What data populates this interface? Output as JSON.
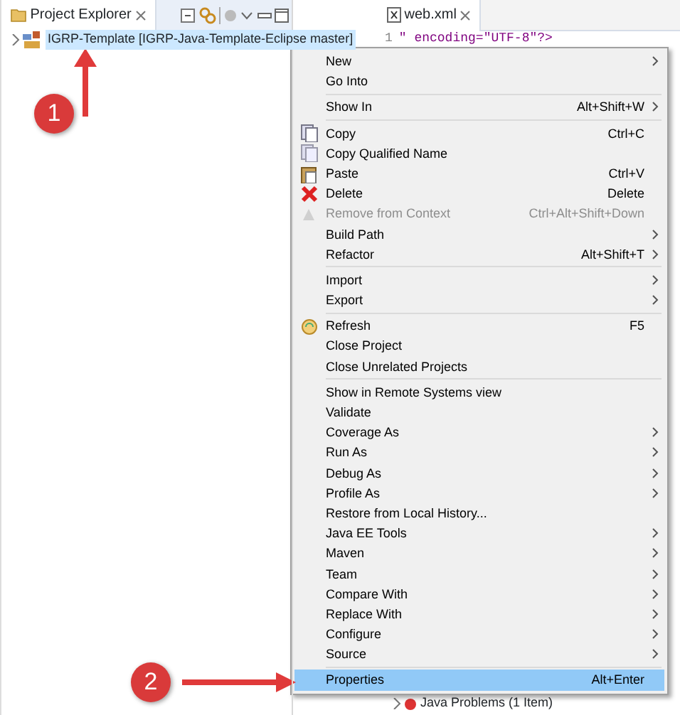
{
  "explorer": {
    "title": "Project Explorer",
    "tree": [
      {
        "label": "IGRP-Template [IGRP-Java-Template-Eclipse master]",
        "expanded": false,
        "selected": true
      }
    ]
  },
  "editor": {
    "tab": "web.xml",
    "lines": [
      {
        "number": "1",
        "code": "\" encoding=\"UTF-8\"?>"
      }
    ],
    "problems": "Java Problems (1 Item)"
  },
  "context_menu": {
    "groups": [
      [
        {
          "label": "New",
          "submenu": true,
          "kind": "plain",
          "disabled": false,
          "selected": false
        },
        {
          "label": "Go Into",
          "submenu": false,
          "kind": "plain",
          "disabled": false,
          "selected": false
        }
      ],
      [
        {
          "label": "Show In",
          "shortcut": "Alt+Shift+W",
          "submenu": true,
          "kind": "plain",
          "disabled": false,
          "selected": false
        }
      ],
      [
        {
          "label": "Copy",
          "shortcut": "Ctrl+C",
          "submenu": false,
          "kind": "copy",
          "disabled": false,
          "selected": false
        },
        {
          "label": "Copy Qualified Name",
          "submenu": false,
          "kind": "copy-name",
          "disabled": false,
          "selected": false
        },
        {
          "label": "Paste",
          "shortcut": "Ctrl+V",
          "submenu": false,
          "kind": "paste",
          "disabled": false,
          "selected": false
        },
        {
          "label": "Delete",
          "shortcut": "Delete",
          "submenu": false,
          "kind": "delete",
          "disabled": false,
          "selected": false
        },
        {
          "label": "Remove from Context",
          "shortcut": "Ctrl+Alt+Shift+Down",
          "submenu": false,
          "kind": "remove",
          "disabled": true,
          "selected": false
        },
        {
          "label": "Build Path",
          "submenu": true,
          "kind": "plain",
          "disabled": false,
          "selected": false
        },
        {
          "label": "Refactor",
          "shortcut": "Alt+Shift+T",
          "submenu": true,
          "kind": "plain",
          "disabled": false,
          "selected": false
        }
      ],
      [
        {
          "label": "Import",
          "submenu": true,
          "kind": "plain",
          "disabled": false,
          "selected": false
        },
        {
          "label": "Export",
          "submenu": true,
          "kind": "plain",
          "disabled": false,
          "selected": false
        }
      ],
      [
        {
          "label": "Refresh",
          "shortcut": "F5",
          "submenu": false,
          "kind": "refresh",
          "disabled": false,
          "selected": false
        },
        {
          "label": "Close Project",
          "submenu": false,
          "kind": "plain",
          "disabled": false,
          "selected": false
        },
        {
          "label": "Close Unrelated Projects",
          "submenu": false,
          "kind": "plain",
          "disabled": false,
          "selected": false
        }
      ],
      [
        {
          "label": "Show in Remote Systems view",
          "submenu": false,
          "kind": "plain",
          "disabled": false,
          "selected": false
        },
        {
          "label": "Validate",
          "submenu": false,
          "kind": "plain",
          "disabled": false,
          "selected": false
        },
        {
          "label": "Coverage As",
          "submenu": true,
          "kind": "plain",
          "disabled": false,
          "selected": false
        },
        {
          "label": "Run As",
          "submenu": true,
          "kind": "plain",
          "disabled": false,
          "selected": false
        },
        {
          "label": "Debug As",
          "submenu": true,
          "kind": "plain",
          "disabled": false,
          "selected": false
        },
        {
          "label": "Profile As",
          "submenu": true,
          "kind": "plain",
          "disabled": false,
          "selected": false
        },
        {
          "label": "Restore from Local History...",
          "submenu": false,
          "kind": "plain",
          "disabled": false,
          "selected": false
        },
        {
          "label": "Java EE Tools",
          "submenu": true,
          "kind": "plain",
          "disabled": false,
          "selected": false
        },
        {
          "label": "Maven",
          "submenu": true,
          "kind": "plain",
          "disabled": false,
          "selected": false
        },
        {
          "label": "Team",
          "submenu": true,
          "kind": "plain",
          "disabled": false,
          "selected": false
        },
        {
          "label": "Compare With",
          "submenu": true,
          "kind": "plain",
          "disabled": false,
          "selected": false
        },
        {
          "label": "Replace With",
          "submenu": true,
          "kind": "plain",
          "disabled": false,
          "selected": false
        },
        {
          "label": "Configure",
          "submenu": true,
          "kind": "plain",
          "disabled": false,
          "selected": false
        },
        {
          "label": "Source",
          "submenu": true,
          "kind": "plain",
          "disabled": false,
          "selected": false
        }
      ],
      [
        {
          "label": "Properties",
          "shortcut": "Alt+Enter",
          "submenu": false,
          "kind": "plain",
          "disabled": false,
          "selected": true
        }
      ]
    ]
  },
  "annotations": [
    {
      "label": "1"
    },
    {
      "label": "2"
    }
  ]
}
